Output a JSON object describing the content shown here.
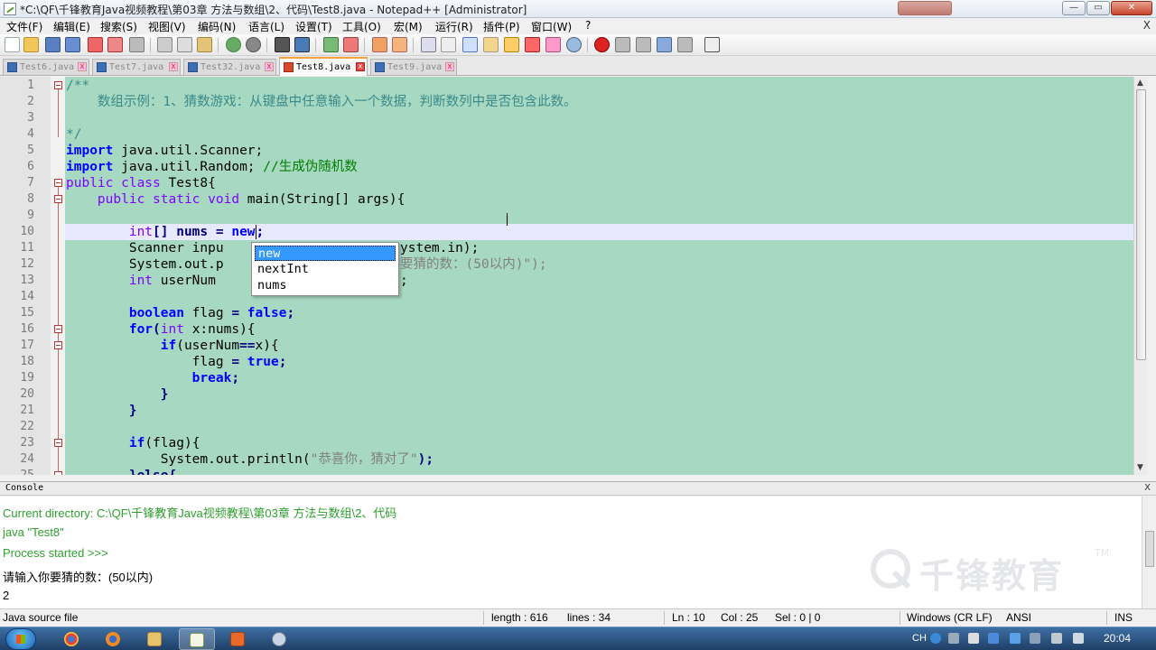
{
  "window": {
    "title": "*C:\\QF\\千锋教育Java视频教程\\第03章 方法与数组\\2、代码\\Test8.java - Notepad++ [Administrator]",
    "min_label": "—",
    "max_label": "▭",
    "close_label": "✕"
  },
  "menu": {
    "items": [
      "文件(F)",
      "编辑(E)",
      "搜索(S)",
      "视图(V)",
      "编码(N)",
      "语言(L)",
      "设置(T)",
      "工具(O)",
      "宏(M)",
      "运行(R)",
      "插件(P)",
      "窗口(W)",
      "?"
    ],
    "close_doc": "X"
  },
  "tabs": [
    {
      "label": "Test6.java",
      "active": false
    },
    {
      "label": "Test7.java",
      "active": false
    },
    {
      "label": "Test32.java",
      "active": false
    },
    {
      "label": "Test8.java",
      "active": true
    },
    {
      "label": "Test9.java",
      "active": false
    }
  ],
  "editor": {
    "line_numbers": [
      "1",
      "2",
      "3",
      "4",
      "5",
      "6",
      "7",
      "8",
      "9",
      "10",
      "11",
      "12",
      "13",
      "14",
      "15",
      "16",
      "17",
      "18",
      "19",
      "20",
      "21",
      "22",
      "23",
      "24",
      "25"
    ],
    "current_line": 10,
    "lines": {
      "l1": "/**",
      "l2": "    数组示例：1、猜数游戏：从键盘中任意输入一个数据，判断数列中是否包含此数。",
      "l4": "*/",
      "l5a": "import",
      "l5b": " java.util.Scanner;",
      "l6a": "import",
      "l6b": " java.util.Random;",
      "l6c": " //生成伪随机数",
      "l7a": "public class",
      "l7b": " Test8{",
      "l8a": "    public static void",
      "l8b": " main(String[] args){",
      "l10a": "        int",
      "l10b": "[] nums ",
      "l10c": "=",
      "l10d": " new",
      "l10e": ";",
      "l11a": "        Scanner inpu",
      "l11b": "ystem.in);",
      "l12a": "        System.out.p",
      "l12b": "要猜的数：(50以内)\");",
      "l13a": "        int",
      "l13b": " userNum ",
      "l13c": ";",
      "l15a": "        boolean",
      "l15b": " flag ",
      "l15c": "=",
      "l15d": " false",
      "l15e": ";",
      "l16a": "        for",
      "l16b": "(",
      "l16c": "int",
      "l16d": " x:nums){",
      "l17a": "            if",
      "l17b": "(userNum",
      "l17c": "==",
      "l17d": "x){",
      "l18a": "                flag ",
      "l18b": "=",
      "l18c": " true",
      "l18d": ";",
      "l19a": "                break",
      "l19b": ";",
      "l20": "            }",
      "l21": "        }",
      "l23a": "        if",
      "l23b": "(flag){",
      "l24a": "            System.out.println(",
      "l24b": "\"恭喜你，猜对了\"",
      "l24c": ");",
      "l25a": "        }else{"
    }
  },
  "autocomplete": {
    "items": [
      "new",
      "nextInt",
      "nums"
    ],
    "selected_index": 0
  },
  "console": {
    "title": "Console",
    "close_label": "X",
    "lines": [
      "Current directory: C:\\QF\\千锋教育Java视频教程\\第03章 方法与数组\\2、代码",
      "java \"Test8\"",
      "Process started >>>",
      "请输入你要猜的数：(50以内)",
      "2"
    ],
    "watermark": "千锋教育",
    "watermark_tm": "TM"
  },
  "status": {
    "file_type": "Java source file",
    "length": "length : 616",
    "lines": "lines : 34",
    "ln": "Ln : 10",
    "col": "Col : 25",
    "sel": "Sel : 0 | 0",
    "eol": "Windows (CR LF)",
    "encoding": "ANSI",
    "mode": "INS"
  },
  "taskbar": {
    "ime": "CH",
    "clock": "20:04"
  },
  "colors": {
    "code_background": "#a7d9c2",
    "current_line": "#e8e8ff",
    "keyword": "#0000ff",
    "comment": "#008000",
    "active_tab_accent": "#f3a23c"
  }
}
